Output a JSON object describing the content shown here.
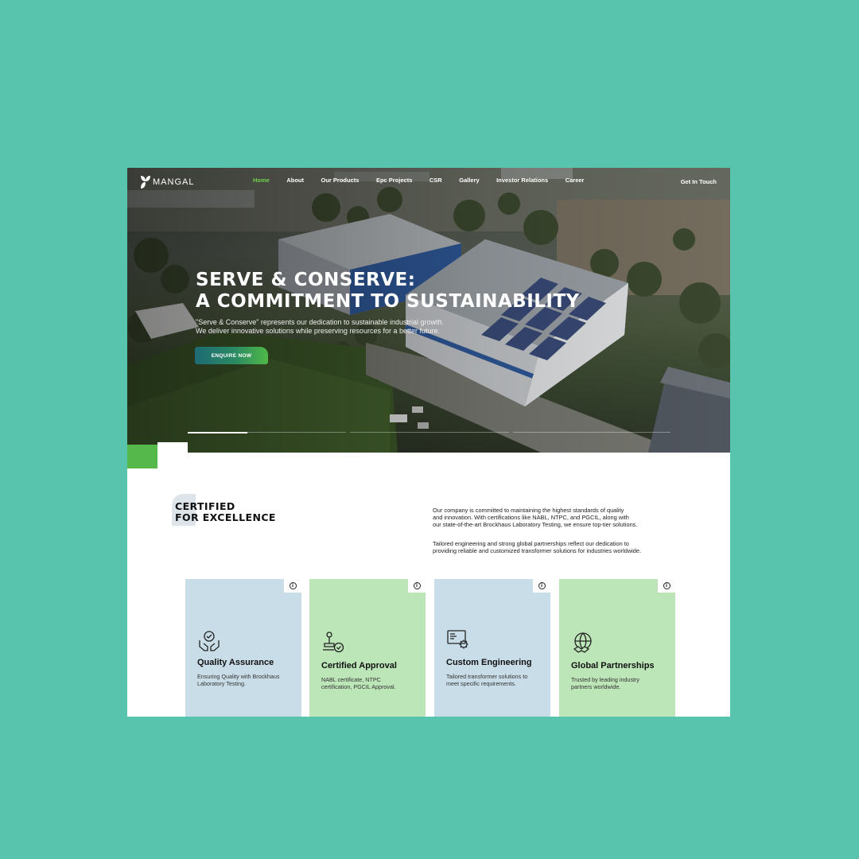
{
  "brand": {
    "name": "MANGAL"
  },
  "nav": {
    "items": [
      {
        "label": "Home",
        "active": true
      },
      {
        "label": "About"
      },
      {
        "label": "Our Products"
      },
      {
        "label": "Epc Projects"
      },
      {
        "label": "CSR"
      },
      {
        "label": "Gallery"
      },
      {
        "label": "Investor Relations"
      },
      {
        "label": "Career"
      }
    ],
    "cta": "Get In Touch"
  },
  "hero": {
    "title_line1": "SERVE & CONSERVE:",
    "title_line2": "A COMMITMENT TO SUSTAINABILITY",
    "subtitle_line1": "\"Serve & Conserve\" represents our dedication to sustainable industrial growth.",
    "subtitle_line2": "We deliver innovative solutions while preserving resources for a better future.",
    "button": "ENQUIRE NOW",
    "slides_total": 3,
    "slide_active": 1
  },
  "certified": {
    "title_line1": "CERTIFIED",
    "title_line2": "FOR EXCELLENCE",
    "para1_line1": "Our company is committed to maintaining the highest standards of quality",
    "para1_line2": "and innovation. With certifications like NABL, NTPC, and PGCIL, along with",
    "para1_line3": "our state-of-the-art Brockhaus Laboratory Testing, we ensure top-tier solutions.",
    "para2_line1": "Tailored engineering and strong global partnerships reflect our dedication to",
    "para2_line2": "providing reliable and customized transformer solutions for industries worldwide."
  },
  "cards": [
    {
      "title": "Quality Assurance",
      "desc": "Ensuring Quality with Brockhaus Laboratory Testing.",
      "icon": "quality-hands-icon",
      "color": "#c9dde9"
    },
    {
      "title": "Certified Approval",
      "desc": "NABL certificate, NTPC certification, PGCIL Approval.",
      "icon": "stamp-check-icon",
      "color": "#bde6b8"
    },
    {
      "title": "Custom Engineering",
      "desc": "Tailored transformer solutions to meet specific requirements.",
      "icon": "monitor-gear-icon",
      "color": "#c9dde9"
    },
    {
      "title": "Global Partnerships",
      "desc": "Trusted by leading industry partners worldwide.",
      "icon": "globe-handshake-icon",
      "color": "#bde6b8"
    }
  ],
  "info_glyph": "i",
  "colors": {
    "background": "#58c4ad",
    "accent_green": "#55b84a",
    "nav_active": "#6fd24c"
  }
}
